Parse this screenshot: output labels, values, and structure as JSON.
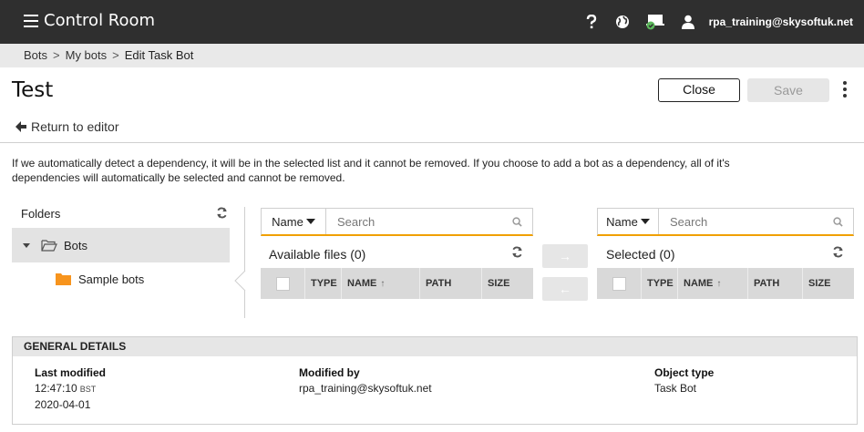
{
  "app": {
    "title": "Control Room",
    "user_email": "rpa_training@skysoftuk.net"
  },
  "header_icons": [
    "help-icon",
    "globe-icon",
    "device-status-icon",
    "user-icon"
  ],
  "breadcrumb": {
    "items": [
      "Bots",
      "My bots"
    ],
    "current": "Edit Task Bot",
    "separator": ">"
  },
  "page": {
    "title": "Test",
    "close_label": "Close",
    "save_label": "Save",
    "return_label": "Return to editor"
  },
  "info_text": "If we automatically detect a dependency, it will be in the selected list and it cannot be removed. If you choose to add a bot as a dependency, all of it's dependencies will automatically be selected and cannot be removed.",
  "folders": {
    "title": "Folders",
    "items": [
      {
        "label": "Bots",
        "expanded": true,
        "selected": true
      },
      {
        "label": "Sample bots",
        "color": "#f7941d"
      }
    ]
  },
  "available": {
    "filter_label": "Name",
    "search_placeholder": "Search",
    "title": "Available files (0)",
    "columns": [
      "TYPE",
      "NAME",
      "PATH",
      "SIZE"
    ]
  },
  "selected": {
    "filter_label": "Name",
    "search_placeholder": "Search",
    "title": "Selected (0)",
    "columns": [
      "TYPE",
      "NAME",
      "PATH",
      "SIZE"
    ]
  },
  "move_buttons": {
    "add": "→",
    "remove": "←"
  },
  "general_details": {
    "title": "GENERAL DETAILS",
    "last_modified_label": "Last modified",
    "last_modified_time": "12:47:10",
    "last_modified_tz": "BST",
    "last_modified_date": "2020-04-01",
    "modified_by_label": "Modified by",
    "modified_by_value": "rpa_training@skysoftuk.net",
    "object_type_label": "Object type",
    "object_type_value": "Task Bot"
  },
  "colors": {
    "topbar": "#2f2f2f",
    "accent_underline": "#f0a000",
    "folder_orange": "#f7941d",
    "status_green": "#5cb85c"
  }
}
